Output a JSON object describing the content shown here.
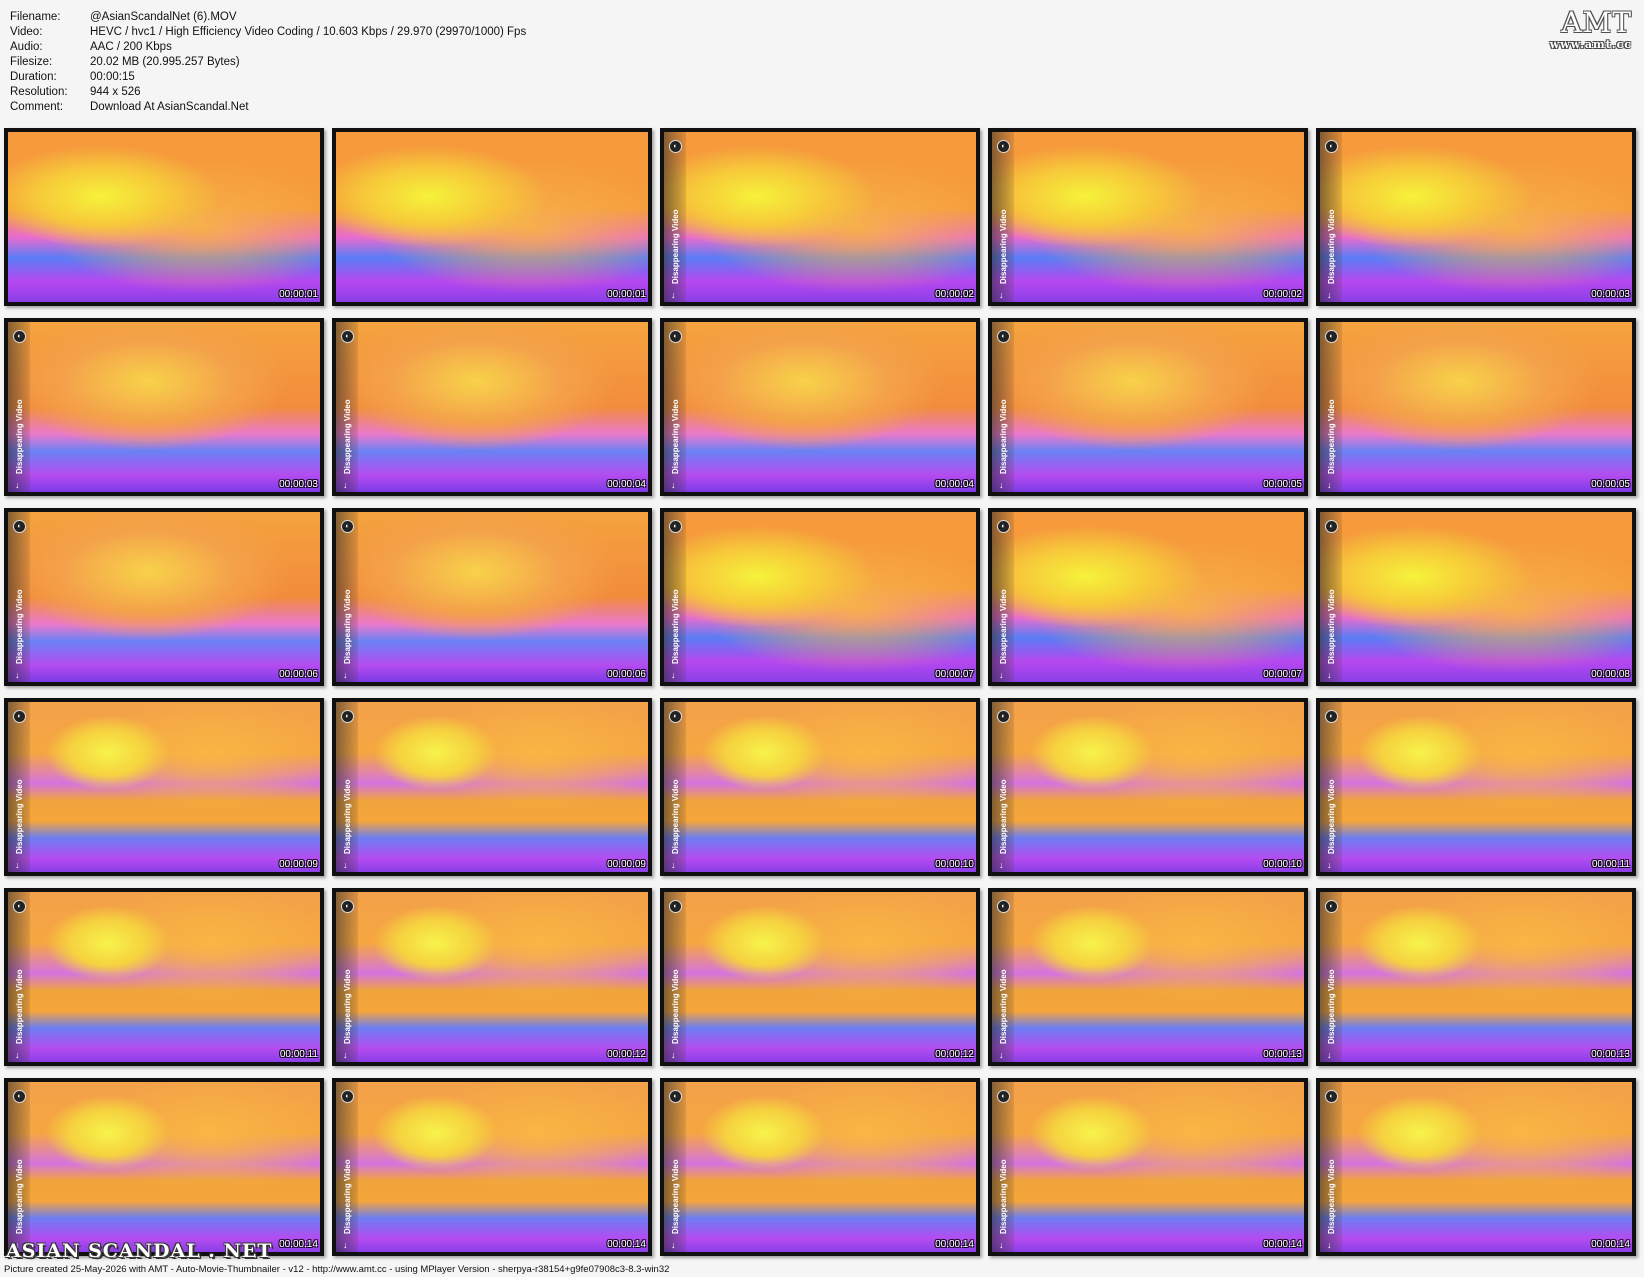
{
  "info": [
    {
      "label": "Filename:",
      "value": "@AsianScandalNet (6).MOV"
    },
    {
      "label": "Video:",
      "value": "HEVC / hvc1 / High Efficiency Video Coding / 10.603 Kbps / 29.970 (29970/1000) Fps"
    },
    {
      "label": "Audio:",
      "value": "AAC / 200 Kbps"
    },
    {
      "label": "Filesize:",
      "value": "20.02 MB (20.995.257 Bytes)"
    },
    {
      "label": "Duration:",
      "value": "00:00:15"
    },
    {
      "label": "Resolution:",
      "value": "944 x 526"
    },
    {
      "label": "Comment:",
      "value": "Download At AsianScandal.Net"
    }
  ],
  "logo": {
    "big": "AMT",
    "small": "www.amt.cc"
  },
  "overlay": {
    "sidebar_text": "Disappearing Video",
    "icon_glyph": "◐",
    "arrow_glyph": "↓"
  },
  "thumbnails": [
    "00:00:01",
    "00:00:01",
    "00:00:02",
    "00:00:02",
    "00:00:03",
    "00:00:03",
    "00:00:04",
    "00:00:04",
    "00:00:05",
    "00:00:05",
    "00:00:06",
    "00:00:06",
    "00:00:07",
    "00:00:07",
    "00:00:08",
    "00:00:09",
    "00:00:09",
    "00:00:10",
    "00:00:10",
    "00:00:11",
    "00:00:11",
    "00:00:12",
    "00:00:12",
    "00:00:13",
    "00:00:13",
    "00:00:14",
    "00:00:14",
    "00:00:14",
    "00:00:14",
    "00:00:14"
  ],
  "watermark": "ASIAN SCANDAL . NET",
  "footer": "Picture created 25-May-2026 with AMT - Auto-Movie-Thumbnailer - v12 - http://www.amt.cc - using MPlayer Version - sherpya-r38154+g9fe07908c3-8.3-win32"
}
